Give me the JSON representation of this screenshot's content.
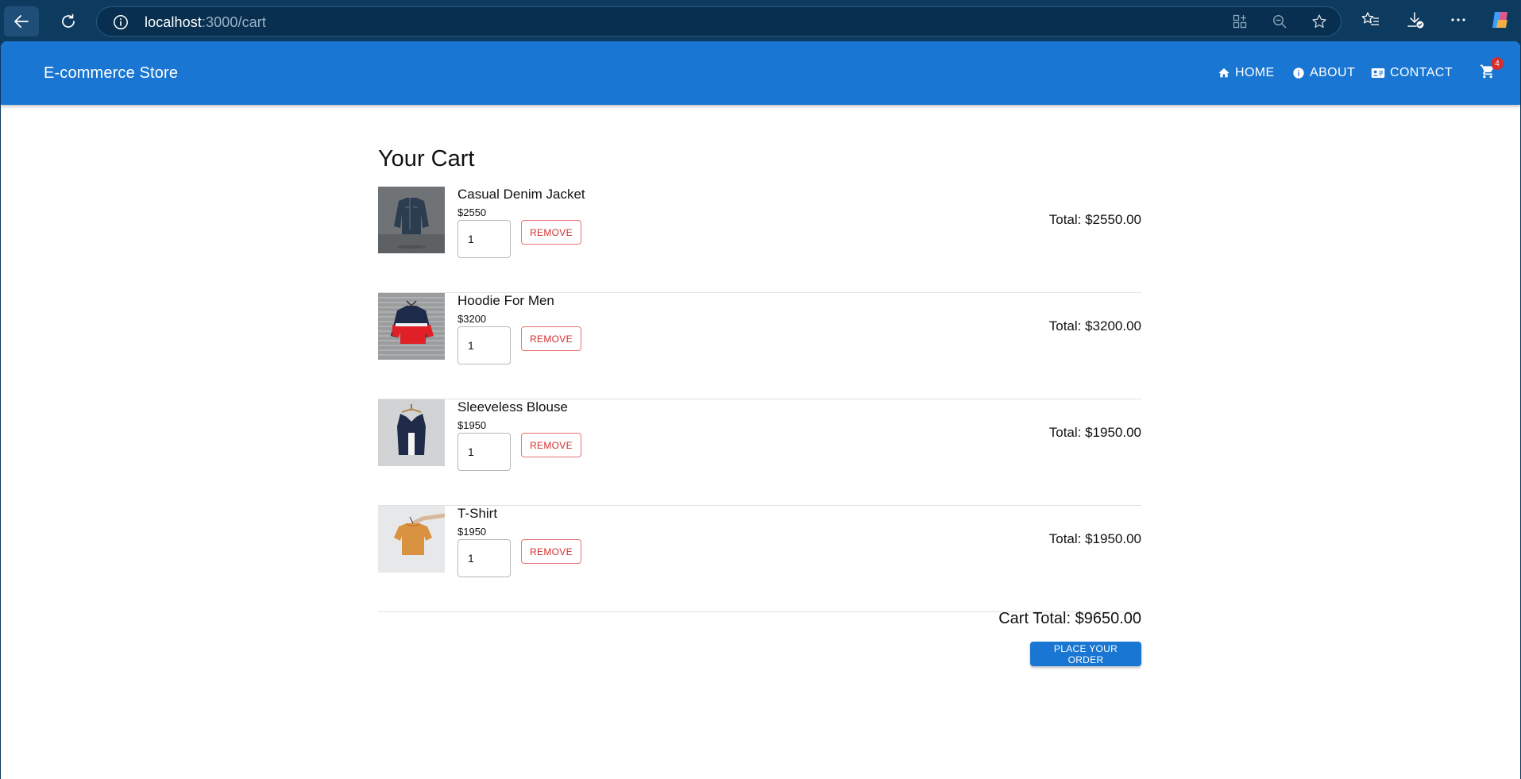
{
  "browser": {
    "url_host": "localhost",
    "url_path": ":3000/cart"
  },
  "store": {
    "brand": "E-commerce Store",
    "nav": {
      "home": "HOME",
      "about": "ABOUT",
      "contact": "CONTACT"
    },
    "cart_badge": "4"
  },
  "cart": {
    "title": "Your Cart",
    "items": [
      {
        "name": "Casual Denim Jacket",
        "price": "$2550",
        "quantity": "1",
        "remove_label": "REMOVE",
        "total": "Total: $2550.00",
        "image_icon": "denim-jacket-image"
      },
      {
        "name": "Hoodie For Men",
        "price": "$3200",
        "quantity": "1",
        "remove_label": "REMOVE",
        "total": "Total: $3200.00",
        "image_icon": "hoodie-image"
      },
      {
        "name": "Sleeveless Blouse",
        "price": "$1950",
        "quantity": "1",
        "remove_label": "REMOVE",
        "total": "Total: $1950.00",
        "image_icon": "blouse-image"
      },
      {
        "name": "T-Shirt",
        "price": "$1950",
        "quantity": "1",
        "remove_label": "REMOVE",
        "total": "Total: $1950.00",
        "image_icon": "tshirt-image"
      }
    ],
    "cart_total": "Cart Total: $9650.00",
    "order_button": "PLACE YOUR ORDER"
  },
  "colors": {
    "appbar": "#1976d2",
    "remove": "#d32f2f",
    "badge": "#d32f2f"
  }
}
